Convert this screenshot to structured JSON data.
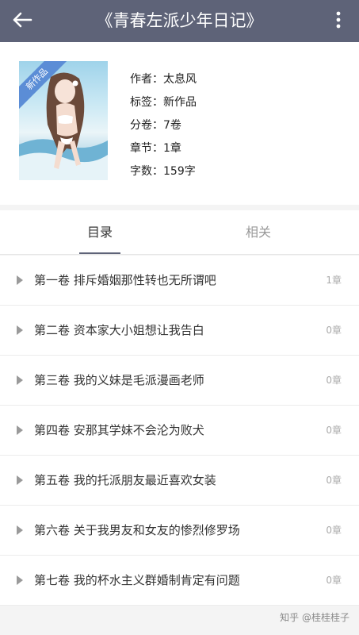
{
  "header": {
    "title": "《青春左派少年日记》",
    "back_icon": "back-arrow-icon",
    "menu_icon": "more-vertical-icon",
    "background_color": "#5e6378"
  },
  "book": {
    "badge": "新作品",
    "fields": [
      {
        "label": "作者：",
        "value": "太息风"
      },
      {
        "label": "标签：",
        "value": "新作品"
      },
      {
        "label": "分卷：",
        "value": "7卷"
      },
      {
        "label": "章节：",
        "value": "1章"
      },
      {
        "label": "字数：",
        "value": "159字"
      }
    ]
  },
  "tabs": [
    {
      "label": "目录",
      "active": true
    },
    {
      "label": "相关",
      "active": false
    }
  ],
  "volumes": [
    {
      "title": "第一卷 排斥婚姻那性转也无所谓吧",
      "count": "1章"
    },
    {
      "title": "第二卷 资本家大小姐想让我告白",
      "count": "0章"
    },
    {
      "title": "第三卷 我的义妹是毛派漫画老师",
      "count": "0章"
    },
    {
      "title": "第四卷 安那其学妹不会沦为败犬",
      "count": "0章"
    },
    {
      "title": "第五卷 我的托派朋友最近喜欢女装",
      "count": "0章"
    },
    {
      "title": "第六卷 关于我男友和女友的惨烈修罗场",
      "count": "0章"
    },
    {
      "title": "第七卷 我的杯水主义群婚制肯定有问题",
      "count": "0章"
    }
  ],
  "watermark": "知乎 @桂桂桂子"
}
